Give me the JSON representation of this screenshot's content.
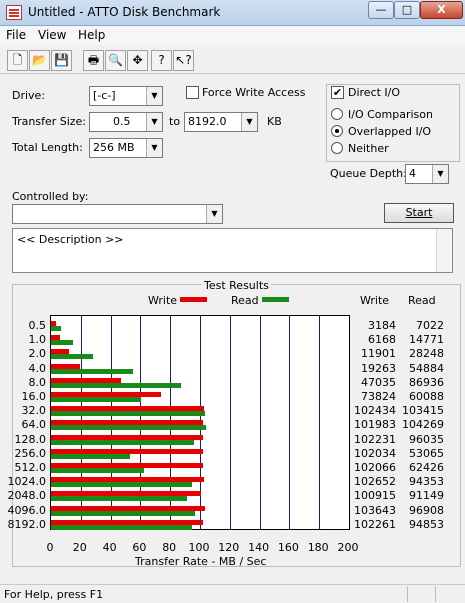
{
  "window": {
    "title": "Untitled - ATTO Disk Benchmark",
    "minimize": "—",
    "maximize": "□",
    "close": "X"
  },
  "menu": [
    "File",
    "View",
    "Help"
  ],
  "toolbar": {
    "icons": [
      "new-file-icon",
      "open-folder-icon",
      "save-icon",
      "print-icon",
      "print-preview-icon",
      "move-icon",
      "help-icon",
      "context-help-icon"
    ],
    "glyphs": [
      "🗋",
      "📂",
      "💾",
      "🖶",
      "🔍",
      "✥",
      "?",
      "↖?"
    ]
  },
  "form": {
    "drive_label": "Drive:",
    "drive_value": "[-c-]",
    "force_write_label": "Force Write Access",
    "direct_io_label": "Direct I/O",
    "direct_io_checked": true,
    "transfer_size_label": "Transfer Size:",
    "transfer_from": "0.5",
    "to_label": "to",
    "transfer_to": "8192.0",
    "kb_label": "KB",
    "total_length_label": "Total Length:",
    "total_length_value": "256 MB",
    "io_comparison_label": "I/O Comparison",
    "overlapped_io_label": "Overlapped I/O",
    "neither_label": "Neither",
    "queue_depth_label": "Queue Depth:",
    "queue_depth_value": "4",
    "controlled_by_label": "Controlled by:",
    "controlled_by_value": "",
    "start_label": "Start",
    "description": "<< Description >>"
  },
  "results": {
    "title": "Test Results",
    "legend_write": "Write",
    "legend_read": "Read",
    "col_write": "Write",
    "col_read": "Read",
    "write_color": "#e60000",
    "read_color": "#1a8a1a"
  },
  "chart_data": {
    "type": "bar",
    "orientation": "horizontal",
    "title": "Test Results",
    "xlabel": "Transfer Rate - MB / Sec",
    "xlim": [
      0,
      200
    ],
    "xticks": [
      0,
      20,
      40,
      60,
      80,
      100,
      120,
      140,
      160,
      180,
      200
    ],
    "categories": [
      "0.5",
      "1.0",
      "2.0",
      "4.0",
      "8.0",
      "16.0",
      "32.0",
      "64.0",
      "128.0",
      "256.0",
      "512.0",
      "1024.0",
      "2048.0",
      "4096.0",
      "8192.0"
    ],
    "series": [
      {
        "name": "Write",
        "values": [
          3184,
          6168,
          11901,
          19263,
          47035,
          73824,
          102434,
          101983,
          102231,
          102034,
          102066,
          102652,
          100915,
          103643,
          102261
        ]
      },
      {
        "name": "Read",
        "values": [
          7022,
          14771,
          28248,
          54884,
          86936,
          60088,
          103415,
          104269,
          96035,
          53065,
          62426,
          94353,
          91149,
          96908,
          94853
        ]
      }
    ]
  },
  "status": {
    "text": "For Help, press F1"
  }
}
